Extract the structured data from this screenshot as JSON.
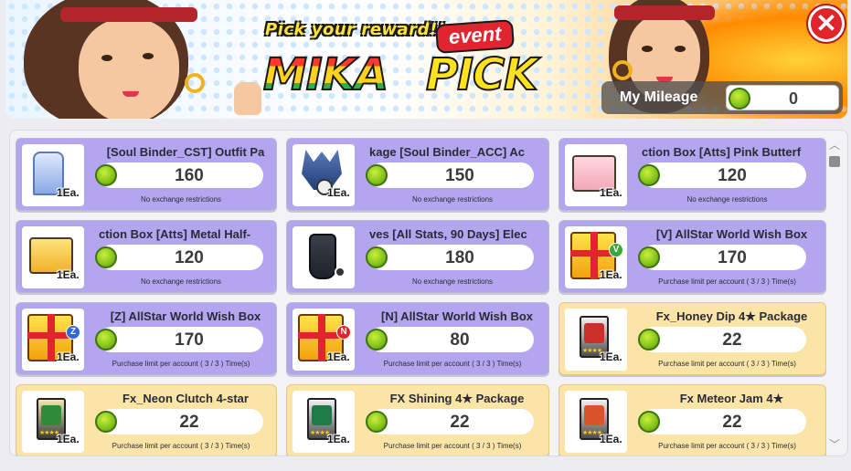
{
  "banner": {
    "tagline": "Pick your reward!!",
    "event_badge": "event",
    "title_part1": "MIKA",
    "title_part2": "PICK"
  },
  "mileage": {
    "label": "My Mileage",
    "value": "0"
  },
  "items": [
    {
      "name": "[Soul Binder_CST] Outfit Pa",
      "price": "160",
      "qty": "1Ea.",
      "limit": "No exchange restrictions",
      "style": "purple",
      "icon": "outfit-icon"
    },
    {
      "name": "kage   [Soul Binder_ACC] Ac",
      "price": "150",
      "qty": "1Ea.",
      "limit": "No exchange restrictions",
      "style": "purple",
      "icon": "armor-skull-icon"
    },
    {
      "name": "ction Box   [Atts] Pink Butterf",
      "price": "120",
      "qty": "1Ea.",
      "limit": "No exchange restrictions",
      "style": "purple",
      "icon": "pink-box-icon"
    },
    {
      "name": "ction Box   [Atts] Metal Half-",
      "price": "120",
      "qty": "1Ea.",
      "limit": "No exchange restrictions",
      "style": "purple",
      "icon": "gold-box-icon"
    },
    {
      "name": "ves   [All Stats, 90 Days] Elec",
      "price": "180",
      "qty": "",
      "limit": "No exchange restrictions",
      "style": "purple",
      "icon": "glove-icon"
    },
    {
      "name": "[V] AllStar World Wish Box",
      "price": "170",
      "qty": "1Ea.",
      "limit": "Purchase limit per account ( 3 / 3 ) Time(s)",
      "style": "purple",
      "icon": "wish-box-v-icon"
    },
    {
      "name": "[Z] AllStar World Wish Box",
      "price": "170",
      "qty": "1Ea.",
      "limit": "Purchase limit per account ( 3 / 3 ) Time(s)",
      "style": "purple",
      "icon": "wish-box-z-icon"
    },
    {
      "name": "[N] AllStar World Wish Box",
      "price": "80",
      "qty": "1Ea.",
      "limit": "Purchase limit per account ( 3 / 3 ) Time(s)",
      "style": "purple",
      "icon": "wish-box-n-icon"
    },
    {
      "name": "Fx_Honey Dip 4★ Package",
      "price": "22",
      "qty": "1Ea.",
      "limit": "Purchase limit per account ( 3 / 3 ) Time(s)",
      "style": "yellow",
      "icon": "honey-dip-package-icon"
    },
    {
      "name": "Fx_Neon Clutch 4-star",
      "price": "22",
      "qty": "1Ea.",
      "limit": "Purchase limit per account ( 3 / 3 ) Time(s)",
      "style": "yellow",
      "icon": "neon-clutch-package-icon"
    },
    {
      "name": "FX Shining 4★ Package",
      "price": "22",
      "qty": "1Ea.",
      "limit": "Purchase limit per account ( 3 / 3 ) Time(s)",
      "style": "yellow",
      "icon": "shining-package-icon"
    },
    {
      "name": "Fx Meteor Jam 4★",
      "price": "22",
      "qty": "1Ea.",
      "limit": "Purchase limit per account ( 3 / 3 ) Time(s)",
      "style": "yellow",
      "icon": "meteor-jam-package-icon"
    }
  ],
  "colors": {
    "card_purple": "#b3a6ef",
    "card_yellow": "#fbe5a6",
    "close_red": "#e0242c",
    "coin_green": "#83c21b"
  }
}
